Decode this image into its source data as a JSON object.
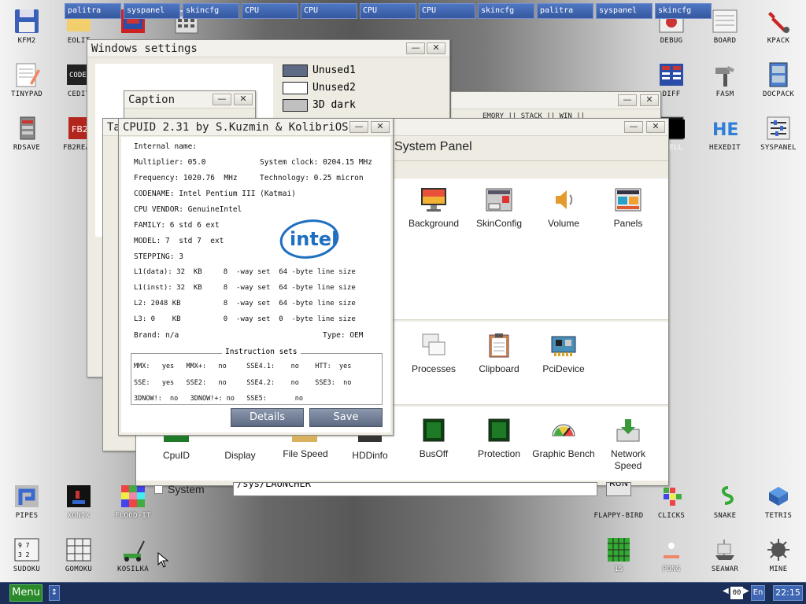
{
  "desktop": {
    "icons": [
      {
        "label": "KFM2"
      },
      {
        "label": "EOLIT"
      },
      {
        "label": "TINYPAD"
      },
      {
        "label": "CEDIT"
      },
      {
        "label": "RDSAVE"
      },
      {
        "label": "FB2READ"
      },
      {
        "label": "DEBUG"
      },
      {
        "label": "BOARD"
      },
      {
        "label": "KPACK"
      },
      {
        "label": "DIFF"
      },
      {
        "label": "FASM"
      },
      {
        "label": "DOCPACK"
      },
      {
        "label": "SHELL"
      },
      {
        "label": "HEXEDIT"
      },
      {
        "label": "SYSPANEL"
      },
      {
        "label": "PIPES"
      },
      {
        "label": "XONIX"
      },
      {
        "label": "FLOOD-IT"
      },
      {
        "label": "SUDOKU"
      },
      {
        "label": "GOMOKU"
      },
      {
        "label": "KOSILKA"
      },
      {
        "label": "FLAPPY-BIRD"
      },
      {
        "label": "CLICKS"
      },
      {
        "label": "SNAKE"
      },
      {
        "label": "TETRIS"
      },
      {
        "label": "15"
      },
      {
        "label": "PONG"
      },
      {
        "label": "SEAWAR"
      },
      {
        "label": "MINE"
      }
    ]
  },
  "windows_settings": {
    "title": "Windows settings",
    "colors": [
      {
        "label": "Unused1",
        "color": "#5f6b84"
      },
      {
        "label": "Unused2",
        "color": "#ffffff"
      },
      {
        "label": "3D dark",
        "color": "#c0c0c0"
      }
    ]
  },
  "caption_window": {
    "title": "Caption",
    "partial_title": "Ta"
  },
  "bg_window": {
    "fragment": "EMORY  || STACK ||   WIN  || "
  },
  "system_panel": {
    "title": "System Panel",
    "items_row1": [
      "Background",
      "SkinConfig",
      "Volume",
      "Panels"
    ],
    "items_row2": [
      "Processes",
      "Clipboard",
      "PciDevice"
    ],
    "items_row3": [
      "CpuID",
      "Display",
      "File Speed",
      "HDDinfo",
      "BusOff",
      "Protection",
      "Graphic Bench",
      "Network Speed"
    ],
    "system_label": "System",
    "path_value": "/sys/LAUNCHER",
    "run_label": "RUN"
  },
  "cpuid": {
    "title": "CPUID 2.31 by S.Kuzmin & KolibriOS",
    "internal_name": "Internal name:",
    "multiplier": "Multiplier: 05.0",
    "system_clock": "System clock: 0204.15 MHz",
    "frequency": "Frequency: 1020.76  MHz",
    "technology": "Technology: 0.25 micron",
    "codename": "CODENAME: Intel Pentium III (Katmai)",
    "vendor": "CPU VENDOR: GenuineIntel",
    "family": "FAMILY: 6 std 6 ext",
    "model": "MODEL: 7  std 7  ext",
    "stepping": "STEPPING: 3",
    "l1data": "L1(data): 32  KB     8  -way set  64 -byte line size",
    "l1inst": "L1(inst): 32  KB     8  -way set  64 -byte line size",
    "l2": "L2: 2048 KB          8  -way set  64 -byte line size",
    "l3": "L3: 0    KB          0  -way set  0  -byte line size",
    "brand": "Brand: n/a",
    "type": "Type: OEM",
    "logo_text": "intel",
    "instr_title": "Instruction sets",
    "instr_row1": "MMX:   yes   MMX+:   no     SSE4.1:    no    HTT:  yes",
    "instr_row2": "SSE:   yes   SSE2:   no     SSE4.2:    no    SSE3:  no",
    "instr_row3": "3DNOW!:  no   3DNOW!+: no   SSE5:       no",
    "details_label": "Details",
    "save_label": "Save"
  },
  "taskbar": {
    "menu_label": "Menu",
    "tasks": [
      "palitra",
      "syspanel",
      "skincfg",
      "CPU",
      "CPU",
      "CPU",
      "CPU",
      "skincfg",
      "palitra",
      "syspanel",
      "skincfg"
    ],
    "counter": "00",
    "lang": "En",
    "clock": "22:15"
  },
  "colors": {
    "taskbar": "#1b2e58",
    "task_button": "#3f66b2",
    "button": "#6b7890",
    "menu": "#2a8a2a"
  }
}
